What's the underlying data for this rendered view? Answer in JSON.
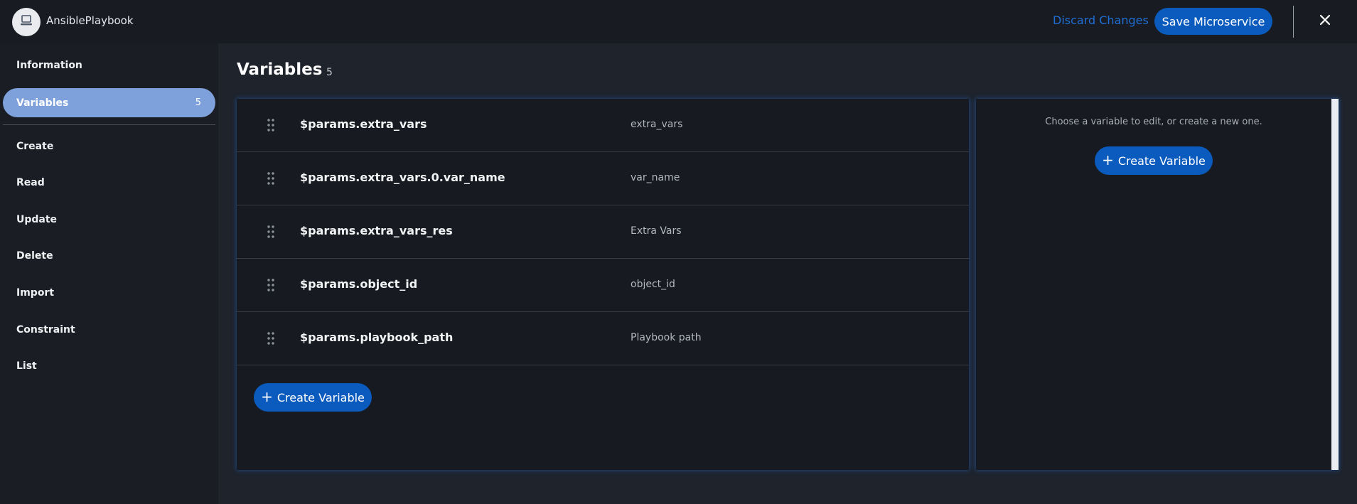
{
  "header": {
    "app_title": "AnsiblePlaybook",
    "avatar_icon": "computer-icon",
    "discard_label": "Discard Changes",
    "save_label": "Save Microservice",
    "close_icon": "close-icon"
  },
  "sidebar": {
    "items": [
      {
        "label": "Information",
        "active": false
      },
      {
        "label": "Variables",
        "active": true,
        "badge": "5"
      },
      {
        "label": "Create",
        "active": false
      },
      {
        "label": "Read",
        "active": false
      },
      {
        "label": "Update",
        "active": false
      },
      {
        "label": "Delete",
        "active": false
      },
      {
        "label": "Import",
        "active": false
      },
      {
        "label": "Constraint",
        "active": false
      },
      {
        "label": "List",
        "active": false
      }
    ]
  },
  "main": {
    "title": "Variables",
    "count": "5",
    "variables": [
      {
        "name": "$params.extra_vars",
        "label": "extra_vars"
      },
      {
        "name": "$params.extra_vars.0.var_name",
        "label": "var_name"
      },
      {
        "name": "$params.extra_vars_res",
        "label": "Extra Vars"
      },
      {
        "name": "$params.object_id",
        "label": "object_id"
      },
      {
        "name": "$params.playbook_path",
        "label": "Playbook path"
      }
    ],
    "create_label": "Create Variable"
  },
  "editor": {
    "hint": "Choose a variable to edit, or create a new one.",
    "create_label": "Create Variable"
  },
  "colors": {
    "accent": "#0a5bbd",
    "link": "#1f6fd6",
    "active_nav": "#7ea1db"
  }
}
